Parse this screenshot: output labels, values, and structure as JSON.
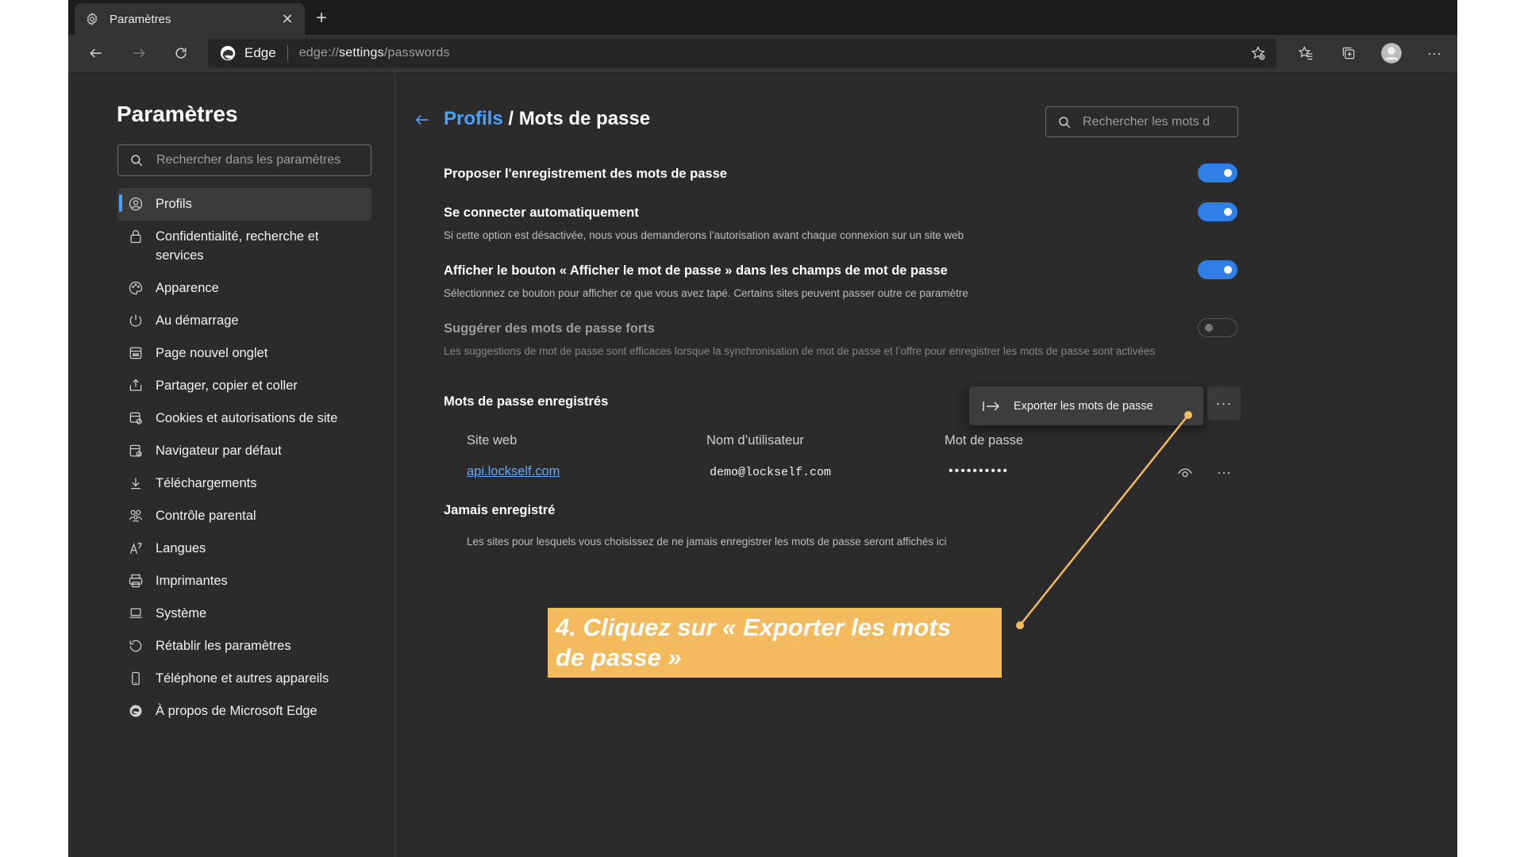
{
  "tab": {
    "title": "Paramètres"
  },
  "toolbar": {
    "brand": "Edge",
    "url_prefix": "edge://",
    "url_main": "settings",
    "url_suffix": "/passwords"
  },
  "sidebar": {
    "title": "Paramètres",
    "search_placeholder": "Rechercher dans les paramètres",
    "items": [
      {
        "label": "Profils",
        "icon": "profile-icon",
        "active": true
      },
      {
        "label": "Confidentialité, recherche et services",
        "icon": "lock-icon"
      },
      {
        "label": "Apparence",
        "icon": "palette-icon"
      },
      {
        "label": "Au démarrage",
        "icon": "power-icon"
      },
      {
        "label": "Page nouvel onglet",
        "icon": "new-tab-page-icon"
      },
      {
        "label": "Partager, copier et coller",
        "icon": "share-icon"
      },
      {
        "label": "Cookies et autorisations de site",
        "icon": "site-permissions-icon"
      },
      {
        "label": "Navigateur par défaut",
        "icon": "default-browser-icon"
      },
      {
        "label": "Téléchargements",
        "icon": "download-icon"
      },
      {
        "label": "Contrôle parental",
        "icon": "family-icon"
      },
      {
        "label": "Langues",
        "icon": "language-icon"
      },
      {
        "label": "Imprimantes",
        "icon": "printer-icon"
      },
      {
        "label": "Système",
        "icon": "laptop-icon"
      },
      {
        "label": "Rétablir les paramètres",
        "icon": "reset-icon"
      },
      {
        "label": "Téléphone et autres appareils",
        "icon": "phone-icon"
      },
      {
        "label": "À propos de Microsoft Edge",
        "icon": "edge-icon"
      }
    ]
  },
  "main": {
    "breadcrumb_parent": "Profils",
    "breadcrumb_current": " / Mots de passe",
    "search_placeholder": "Rechercher les mots d",
    "settings": [
      {
        "title": "Proposer l'enregistrement des mots de passe",
        "desc": "",
        "on": true
      },
      {
        "title": "Se connecter automatiquement",
        "desc": "Si cette option est désactivée, nous vous demanderons l’autorisation avant chaque connexion sur un site web",
        "on": true
      },
      {
        "title": "Afficher le bouton « Afficher le mot de passe » dans les champs de mot de passe",
        "desc": "Sélectionnez ce bouton pour afficher ce que vous avez tapé. Certains sites peuvent passer outre ce paramètre",
        "on": true
      },
      {
        "title": "Suggérer des mots de passe forts",
        "desc": "Les suggestions de mot de passe sont efficaces lorsque la synchronisation de mot de passe et l’offre pour enregistrer les mots de passe sont activées",
        "on": false,
        "disabled": true
      }
    ],
    "saved": {
      "title": "Mots de passe enregistrés",
      "export_label": "Exporter les mots de passe",
      "columns": [
        "Site web",
        "Nom d’utilisateur",
        "Mot de passe"
      ],
      "rows": [
        {
          "site": "api.lockself.com",
          "user": "demo@lockself.com",
          "password": "••••••••••"
        }
      ]
    },
    "never": {
      "title": "Jamais enregistré",
      "desc": "Les sites pour lesquels vous choisissez de ne jamais enregistrer les mots de passe seront affichés ici"
    }
  },
  "annotation": {
    "line1": "4. Cliquez sur « Exporter les mots",
    "line2": "de passe »",
    "color": "#f3bb5e"
  },
  "colors": {
    "accent": "#4aa0ff",
    "toggle_on": "#2f7fe6",
    "bg": "#2b2b2b"
  }
}
